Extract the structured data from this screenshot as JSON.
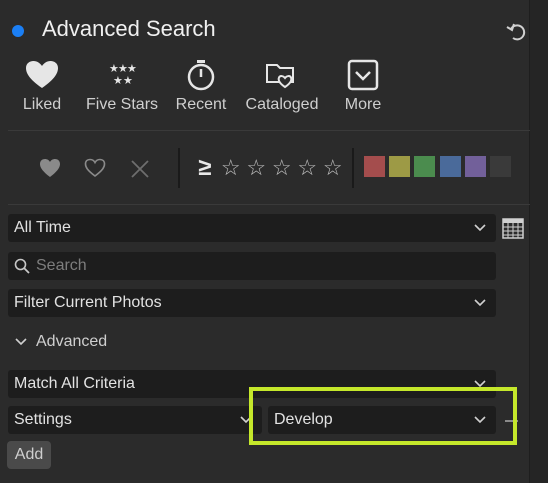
{
  "header": {
    "title": "Advanced Search",
    "accent_color": "#1b7ff5",
    "reset_icon": "undo-icon"
  },
  "presets": [
    {
      "label": "Liked",
      "icon": "heart-icon"
    },
    {
      "label": "Five Stars",
      "icon": "five-stars-icon"
    },
    {
      "label": "Recent",
      "icon": "stopwatch-icon"
    },
    {
      "label": "Cataloged",
      "icon": "catalog-folder-icon"
    },
    {
      "label": "More",
      "icon": "chevron-box-icon"
    }
  ],
  "flags": {
    "ge_symbol": "≥",
    "star_glyph": "☆",
    "stars_count": 5,
    "color_labels": [
      "#a44d4d",
      "#9d9a45",
      "#4b8c4e",
      "#4a6a9a",
      "#72609a",
      "#3a3a3a"
    ]
  },
  "filters": {
    "time_range": "All Time",
    "search_placeholder": "Search",
    "scope": "Filter Current Photos"
  },
  "advanced": {
    "label": "Advanced",
    "match": "Match All Criteria",
    "criteria_field": "Settings",
    "criteria_value": "Develop",
    "add_label": "Add",
    "highlight_color": "#c5e82b"
  }
}
